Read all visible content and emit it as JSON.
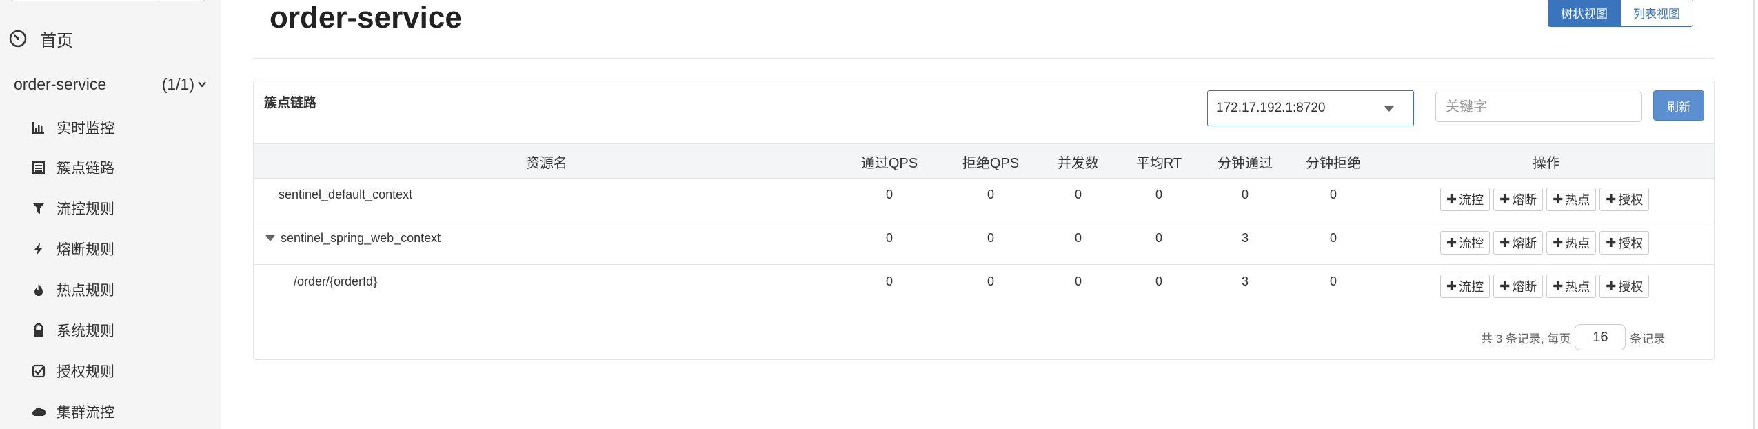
{
  "sidebar": {
    "home_label": "首页",
    "app": {
      "name": "order-service",
      "count": "(1/1)"
    },
    "items": [
      {
        "label": "实时监控",
        "icon": "bar-chart-icon"
      },
      {
        "label": "簇点链路",
        "icon": "list-icon"
      },
      {
        "label": "流控规则",
        "icon": "filter-icon"
      },
      {
        "label": "熔断规则",
        "icon": "bolt-icon"
      },
      {
        "label": "热点规则",
        "icon": "fire-icon"
      },
      {
        "label": "系统规则",
        "icon": "lock-icon"
      },
      {
        "label": "授权规则",
        "icon": "check-square-icon"
      },
      {
        "label": "集群流控",
        "icon": "cloud-icon"
      }
    ]
  },
  "header": {
    "title": "order-service",
    "view_toggle": {
      "tree": "树状视图",
      "list": "列表视图"
    }
  },
  "panel": {
    "title": "簇点链路",
    "machine": "172.17.192.1:8720",
    "keyword_placeholder": "关键字",
    "refresh_label": "刷新"
  },
  "table": {
    "headers": [
      "资源名",
      "通过QPS",
      "拒绝QPS",
      "并发数",
      "平均RT",
      "分钟通过",
      "分钟拒绝",
      "操作"
    ],
    "rows": [
      {
        "resource": "sentinel_default_context",
        "pass_qps": "0",
        "block_qps": "0",
        "concurrency": "0",
        "avg_rt": "0",
        "minute_pass": "0",
        "minute_block": "0"
      },
      {
        "resource": "sentinel_spring_web_context",
        "pass_qps": "0",
        "block_qps": "0",
        "concurrency": "0",
        "avg_rt": "0",
        "minute_pass": "3",
        "minute_block": "0"
      },
      {
        "resource": "/order/{orderId}",
        "pass_qps": "0",
        "block_qps": "0",
        "concurrency": "0",
        "avg_rt": "0",
        "minute_pass": "3",
        "minute_block": "0"
      }
    ],
    "actions": {
      "flow": "流控",
      "degrade": "熔断",
      "hotspot": "热点",
      "authority": "授权"
    }
  },
  "pager": {
    "prefix": "共 3 条记录, 每页",
    "page_size": "16",
    "suffix": "条记录"
  },
  "colors": {
    "accent": "#3a74bd",
    "refresh": "#5b8fd0",
    "sidebar_bg": "#f5f5f5"
  }
}
